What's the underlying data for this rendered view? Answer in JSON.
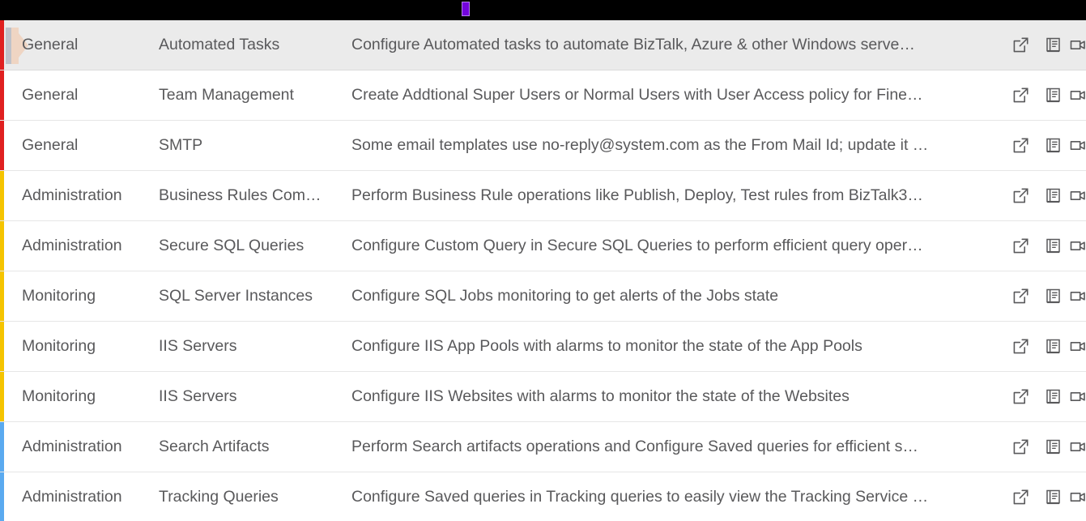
{
  "topbar": {
    "cursor_color": "#7405dd",
    "background": "#000000"
  },
  "table": {
    "selected_row_index": 0,
    "strip_colors": {
      "general": "#e02020",
      "administration_yellow": "#f5c400",
      "monitoring": "#f5c400",
      "administration_blue": "#5aaaf0"
    },
    "actions": {
      "open_label": "Open in new window",
      "docs_label": "Documentation",
      "video_label": "Video"
    },
    "rows": [
      {
        "module": "General",
        "feature": "Automated Tasks",
        "description": "Configure Automated tasks to automate BizTalk, Azure & other Windows serve…",
        "strip": "#e02020"
      },
      {
        "module": "General",
        "feature": "Team Management",
        "description": "Create Addtional Super Users or Normal Users with User Access policy for Fine…",
        "strip": "#e02020"
      },
      {
        "module": "General",
        "feature": "SMTP",
        "description": "Some email templates use no-reply@system.com as the From Mail Id; update it …",
        "strip": "#e02020"
      },
      {
        "module": "Administration",
        "feature": "Business Rules Com…",
        "description": "Perform Business Rule operations like Publish, Deploy, Test rules from BizTalk3…",
        "strip": "#f5c400"
      },
      {
        "module": "Administration",
        "feature": "Secure SQL Queries",
        "description": "Configure Custom Query in Secure SQL Queries to perform efficient query oper…",
        "strip": "#f5c400"
      },
      {
        "module": "Monitoring",
        "feature": "SQL Server Instances",
        "description": "Configure SQL Jobs monitoring to get alerts of the Jobs state",
        "strip": "#f5c400"
      },
      {
        "module": "Monitoring",
        "feature": "IIS Servers",
        "description": "Configure IIS App Pools with alarms to monitor the state of the App Pools",
        "strip": "#f5c400"
      },
      {
        "module": "Monitoring",
        "feature": "IIS Servers",
        "description": "Configure IIS Websites with alarms to monitor the state of the Websites",
        "strip": "#f5c400"
      },
      {
        "module": "Administration",
        "feature": "Search Artifacts",
        "description": "Perform Search artifacts operations and Configure Saved queries for efficient s…",
        "strip": "#5aaaf0"
      },
      {
        "module": "Administration",
        "feature": "Tracking Queries",
        "description": "Configure Saved queries in Tracking queries to easily view the Tracking Service …",
        "strip": "#5aaaf0"
      }
    ]
  }
}
